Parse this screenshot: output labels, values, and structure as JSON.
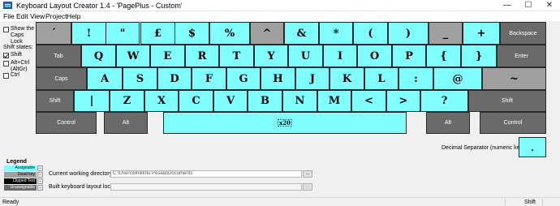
{
  "window": {
    "title": "Keyboard Layout Creator 1.4 - 'PagePlus - Custom'",
    "controls": [
      "—",
      "☐",
      "✕"
    ]
  },
  "menu": [
    "File",
    "Edit",
    "View",
    "Project",
    "Help"
  ],
  "side_panel": {
    "show_caps_lock": "Show the Caps Lock",
    "shift_states_heading": "Shift states:",
    "states": [
      {
        "label": "Shift",
        "checked": true
      },
      {
        "label": "Alt+Ctrl (AltGr)",
        "checked": false
      },
      {
        "label": "Ctrl",
        "checked": false
      }
    ]
  },
  "keyboard": {
    "rows": [
      [
        {
          "label": "´",
          "kind": "dead"
        },
        {
          "label": "!",
          "kind": "assign"
        },
        {
          "label": "\"",
          "kind": "assign"
        },
        {
          "label": "£",
          "kind": "assign"
        },
        {
          "label": "$",
          "kind": "assign"
        },
        {
          "label": "%",
          "kind": "assign"
        },
        {
          "label": "^",
          "kind": "dead"
        },
        {
          "label": "&",
          "kind": "assign"
        },
        {
          "label": "*",
          "kind": "assign"
        },
        {
          "label": "(",
          "kind": "assign"
        },
        {
          "label": ")",
          "kind": "assign"
        },
        {
          "label": "_",
          "kind": "dead"
        },
        {
          "label": "+",
          "kind": "assign"
        },
        {
          "label": "Backspace",
          "kind": "mod"
        }
      ],
      [
        {
          "label": "Tab",
          "kind": "mod"
        },
        {
          "label": "Q",
          "kind": "assign"
        },
        {
          "label": "W",
          "kind": "assign"
        },
        {
          "label": "E",
          "kind": "assign"
        },
        {
          "label": "R",
          "kind": "assign"
        },
        {
          "label": "T",
          "kind": "assign"
        },
        {
          "label": "Y",
          "kind": "assign"
        },
        {
          "label": "U",
          "kind": "assign"
        },
        {
          "label": "I",
          "kind": "assign"
        },
        {
          "label": "O",
          "kind": "assign"
        },
        {
          "label": "P",
          "kind": "assign"
        },
        {
          "label": "{",
          "kind": "assign"
        },
        {
          "label": "}",
          "kind": "assign"
        },
        {
          "label": "Enter",
          "kind": "mod"
        }
      ],
      [
        {
          "label": "Caps",
          "kind": "mod"
        },
        {
          "label": "A",
          "kind": "assign"
        },
        {
          "label": "S",
          "kind": "assign"
        },
        {
          "label": "D",
          "kind": "assign"
        },
        {
          "label": "F",
          "kind": "assign"
        },
        {
          "label": "G",
          "kind": "assign"
        },
        {
          "label": "H",
          "kind": "assign"
        },
        {
          "label": "J",
          "kind": "assign"
        },
        {
          "label": "K",
          "kind": "assign"
        },
        {
          "label": "L",
          "kind": "assign"
        },
        {
          "label": ":",
          "kind": "assign"
        },
        {
          "label": "@",
          "kind": "assign"
        },
        {
          "label": "~",
          "kind": "dead"
        }
      ],
      [
        {
          "label": "Shift",
          "kind": "mod"
        },
        {
          "label": "|",
          "kind": "assign"
        },
        {
          "label": "Z",
          "kind": "assign"
        },
        {
          "label": "X",
          "kind": "assign"
        },
        {
          "label": "C",
          "kind": "assign"
        },
        {
          "label": "V",
          "kind": "assign"
        },
        {
          "label": "B",
          "kind": "assign"
        },
        {
          "label": "N",
          "kind": "assign"
        },
        {
          "label": "M",
          "kind": "assign"
        },
        {
          "label": "<",
          "kind": "assign"
        },
        {
          "label": ">",
          "kind": "assign"
        },
        {
          "label": "?",
          "kind": "assign"
        },
        {
          "label": "Shift",
          "kind": "mod"
        }
      ],
      [
        {
          "label": "Control",
          "kind": "mod"
        },
        {
          "label": "Alt",
          "kind": "mod"
        },
        {
          "label": "x20",
          "kind": "assign",
          "space": true
        },
        {
          "label": "Alt",
          "kind": "mod"
        },
        {
          "label": "Control",
          "kind": "mod"
        }
      ]
    ]
  },
  "legend": {
    "title": "Legend",
    "items": [
      {
        "label": "Assignable",
        "color": "#7ffdff",
        "text": "#000000"
      },
      {
        "label": "Dead key",
        "color": "#a0a0a0",
        "text": "#000000"
      },
      {
        "label": "Clipped Text",
        "color": "#000000",
        "text": "#ffffff"
      },
      {
        "label": "Unassignable",
        "color": "#6a6a6a",
        "text": "#ffffff"
      }
    ],
    "button": "..."
  },
  "fields": {
    "cwd_label": "Current working directory",
    "cwd_value": "C:\\Users\\Bhikkhu Pesala\\Documents",
    "build_label": "Built keyboard layout location",
    "build_value": "",
    "browse": "..."
  },
  "decimal": {
    "label": "Decimal Separator (numeric keypad)",
    "value": "."
  },
  "status": {
    "left": "Ready",
    "right": "Shift"
  },
  "colors": {
    "assignable": "#7ffdff",
    "dead": "#a0a0a0",
    "unassignable": "#6a6a6a"
  }
}
